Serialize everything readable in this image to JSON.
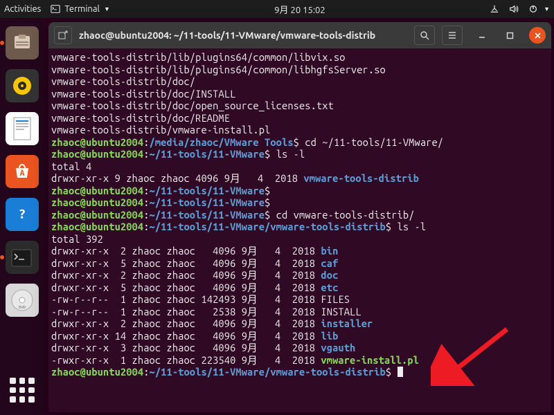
{
  "topbar": {
    "activities": "Activities",
    "app_name": "Terminal",
    "clock": "9月 20  15:02"
  },
  "window": {
    "title": "zhaoc@ubuntu2004: ~/11-tools/11-VMware/vmware-tools-distrib"
  },
  "term": {
    "user_host": "zhaoc@ubuntu2004",
    "colon": ":",
    "dollar": "$",
    "path_media": "/media/zhaoc/VMware Tools",
    "path_vmware": "~/11-tools/11-VMware",
    "path_distrib": "~/11-tools/11-VMware/vmware-tools-distrib",
    "scrollback": [
      "vmware-tools-distrib/lib/plugins64/common/libvix.so",
      "vmware-tools-distrib/lib/plugins64/common/libhgfsServer.so",
      "vmware-tools-distrib/doc/",
      "vmware-tools-distrib/doc/INSTALL",
      "vmware-tools-distrib/doc/open_source_licenses.txt",
      "vmware-tools-distrib/doc/README",
      "vmware-tools-distrib/vmware-install.pl"
    ],
    "cmd1": " cd ~/11-tools/11-VMware/",
    "cmd2": " ls -l",
    "total1": "total 4",
    "ls1_row": "drwxr-xr-x 9 zhaoc zhaoc 4096 9月   4  2018 ",
    "ls1_dir": "vmware-tools-distrib",
    "cmd3": "",
    "cmd4": "",
    "cmd5": " cd vmware-tools-distrib/",
    "cmd6": " ls -l",
    "total2": "total 392",
    "ls2": [
      {
        "perm": "drwxr-xr-x  2 zhaoc zhaoc   4096 9月   4  2018 ",
        "name": "bin",
        "cls": "p-dir"
      },
      {
        "perm": "drwxr-xr-x  5 zhaoc zhaoc   4096 9月   4  2018 ",
        "name": "caf",
        "cls": "p-dir"
      },
      {
        "perm": "drwxr-xr-x  2 zhaoc zhaoc   4096 9月   4  2018 ",
        "name": "doc",
        "cls": "p-dir"
      },
      {
        "perm": "drwxr-xr-x  5 zhaoc zhaoc   4096 9月   4  2018 ",
        "name": "etc",
        "cls": "p-dir"
      },
      {
        "perm": "-rw-r--r--  1 zhaoc zhaoc 142493 9月   4  2018 ",
        "name": "FILES",
        "cls": ""
      },
      {
        "perm": "-rw-r--r--  1 zhaoc zhaoc   2538 9月   4  2018 ",
        "name": "INSTALL",
        "cls": ""
      },
      {
        "perm": "drwxr-xr-x  2 zhaoc zhaoc   4096 9月   4  2018 ",
        "name": "installer",
        "cls": "p-dir"
      },
      {
        "perm": "drwxr-xr-x 14 zhaoc zhaoc   4096 9月   4  2018 ",
        "name": "lib",
        "cls": "p-dir"
      },
      {
        "perm": "drwxr-xr-x  3 zhaoc zhaoc   4096 9月   4  2018 ",
        "name": "vgauth",
        "cls": "p-dir"
      },
      {
        "perm": "-rwxr-xr-x  1 zhaoc zhaoc 223540 9月   4  2018 ",
        "name": "vmware-install.pl",
        "cls": "p-exec"
      }
    ]
  }
}
